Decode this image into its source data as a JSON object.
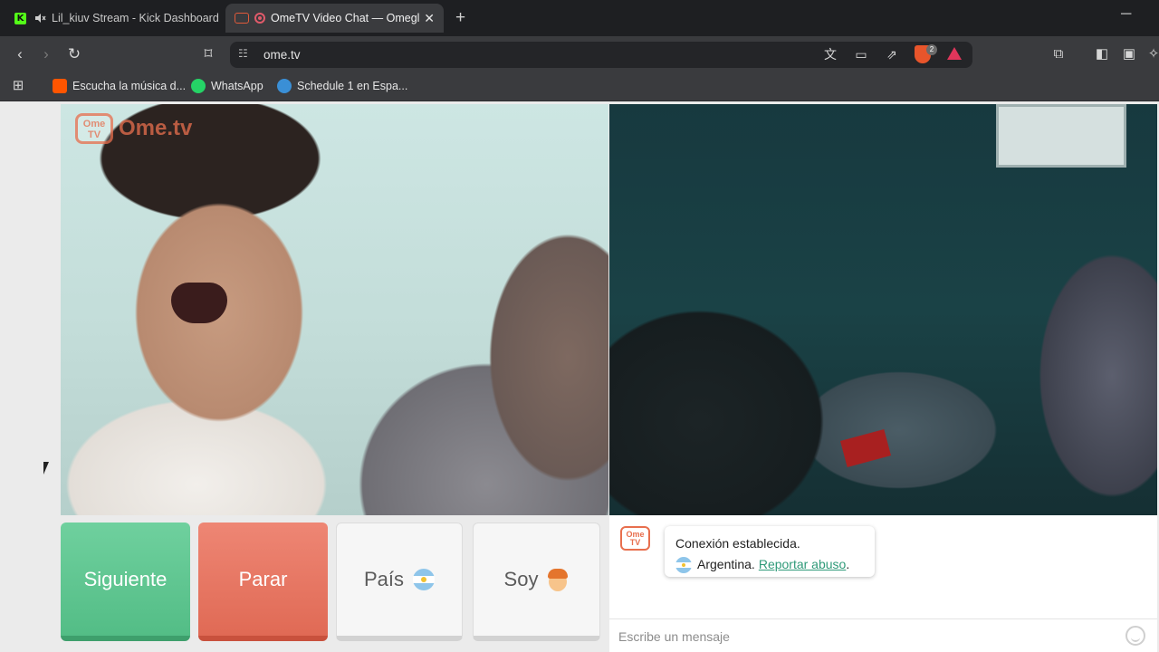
{
  "browser": {
    "tabs": [
      {
        "title": "Lil_kiuv Stream - Kick Dashboard",
        "favicon": "kick-icon",
        "muted": true,
        "active": false
      },
      {
        "title": "OmeTV Video Chat — Omegl",
        "favicon": "ometv-icon",
        "recording": true,
        "active": true
      }
    ],
    "new_tab_symbol": "+",
    "close_symbol": "✕",
    "url": "ome.tv",
    "shields_badge": "2",
    "bookmarks": [
      {
        "label": "Escucha la música d...",
        "icon": "soundcloud-icon",
        "color": "#ff5500"
      },
      {
        "label": "WhatsApp",
        "icon": "whatsapp-icon",
        "color": "#25d366"
      },
      {
        "label": "Schedule 1 en Espa...",
        "icon": "schedule-icon",
        "color": "#3a8fd6"
      }
    ]
  },
  "page": {
    "logo": {
      "badge_text": "Ome TV",
      "name": "Ome.tv"
    },
    "buttons": {
      "next": "Siguiente",
      "stop": "Parar",
      "country": "País",
      "gender": "Soy"
    },
    "chat": {
      "system_line1": "Conexión establecida.",
      "country": "Argentina.",
      "report_link": "Reportar abuso",
      "report_suffix": ".",
      "input_placeholder": "Escribe un mensaje",
      "logo_text": "Ome TV"
    }
  },
  "colors": {
    "next_button": "#5cc48f",
    "stop_button": "#e67560",
    "link": "#2f9a79",
    "brand": "#e86f4e"
  }
}
